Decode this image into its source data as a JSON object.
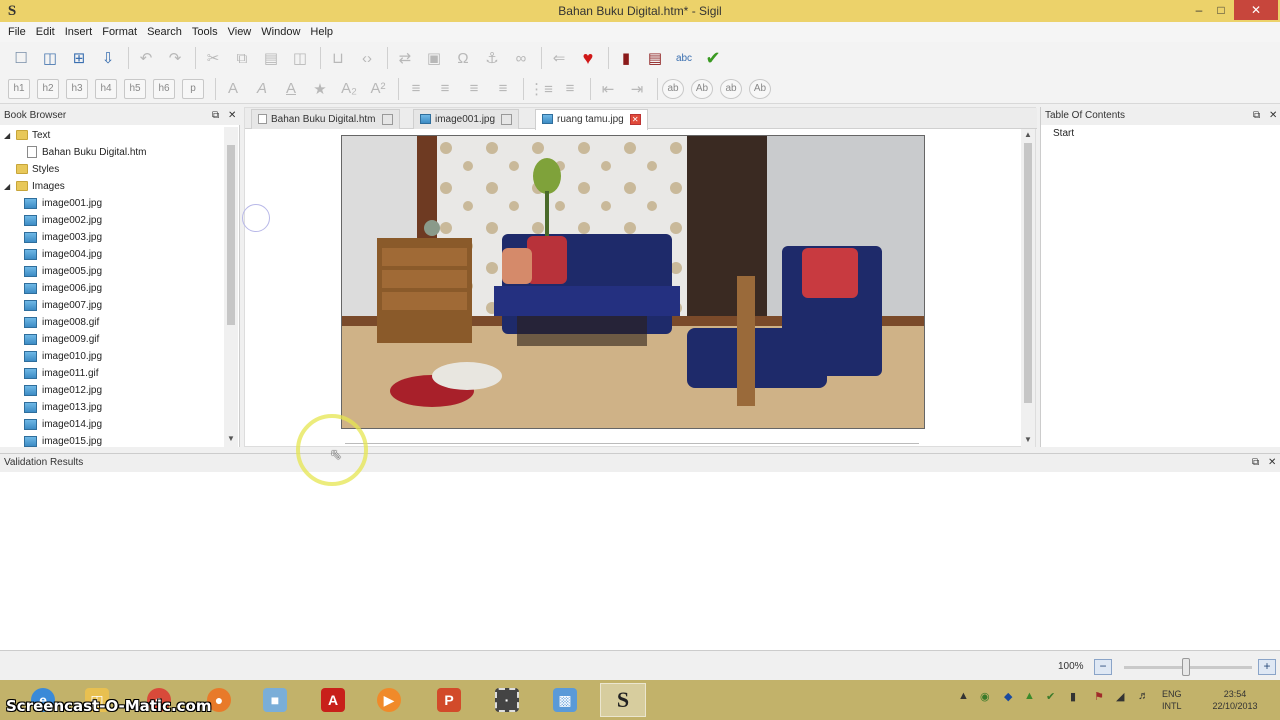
{
  "window": {
    "title": "Bahan Buku Digital.htm* - Sigil",
    "app_icon": "S",
    "minimize": "–",
    "maximize": "□",
    "close": "✕"
  },
  "menu": [
    "File",
    "Edit",
    "Insert",
    "Format",
    "Search",
    "Tools",
    "View",
    "Window",
    "Help"
  ],
  "toolbar2": {
    "headings": [
      "h1",
      "h2",
      "h3",
      "h4",
      "h5",
      "h6",
      "p"
    ],
    "case_buttons": [
      "ab",
      "Ab",
      "ab",
      "Ab"
    ]
  },
  "book_browser": {
    "title": "Book Browser",
    "tree": [
      {
        "label": "Text",
        "type": "folder",
        "level": 0,
        "expanded": true
      },
      {
        "label": "Bahan Buku Digital.htm",
        "type": "file",
        "level": 1
      },
      {
        "label": "Styles",
        "type": "folder",
        "level": 0
      },
      {
        "label": "Images",
        "type": "folder",
        "level": 0,
        "expanded": true
      },
      {
        "label": "image001.jpg",
        "type": "image",
        "level": 1
      },
      {
        "label": "image002.jpg",
        "type": "image",
        "level": 1
      },
      {
        "label": "image003.jpg",
        "type": "image",
        "level": 1
      },
      {
        "label": "image004.jpg",
        "type": "image",
        "level": 1
      },
      {
        "label": "image005.jpg",
        "type": "image",
        "level": 1
      },
      {
        "label": "image006.jpg",
        "type": "image",
        "level": 1
      },
      {
        "label": "image007.jpg",
        "type": "image",
        "level": 1
      },
      {
        "label": "image008.gif",
        "type": "image",
        "level": 1
      },
      {
        "label": "image009.gif",
        "type": "image",
        "level": 1
      },
      {
        "label": "image010.jpg",
        "type": "image",
        "level": 1
      },
      {
        "label": "image011.gif",
        "type": "image",
        "level": 1
      },
      {
        "label": "image012.jpg",
        "type": "image",
        "level": 1
      },
      {
        "label": "image013.jpg",
        "type": "image",
        "level": 1
      },
      {
        "label": "image014.jpg",
        "type": "image",
        "level": 1
      },
      {
        "label": "image015.jpg",
        "type": "image",
        "level": 1
      }
    ]
  },
  "editor": {
    "tabs": [
      {
        "label": "Bahan Buku Digital.htm",
        "icon": "html-file-icon",
        "active": false
      },
      {
        "label": "image001.jpg",
        "icon": "image-file-icon",
        "active": false
      },
      {
        "label": "ruang tamu.jpg",
        "icon": "image-file-icon",
        "active": true
      }
    ]
  },
  "toc": {
    "title": "Table Of Contents",
    "entries": [
      "Start"
    ]
  },
  "validation": {
    "title": "Validation Results"
  },
  "statusbar": {
    "zoom": "100%",
    "zoom_out": "−",
    "zoom_in": "+"
  },
  "taskbar": {
    "watermark": "Screencast-O-Matic.com",
    "language": "ENG",
    "layout": "INTL",
    "time": "23:54",
    "date": "22/10/2013"
  },
  "colors": {
    "titlebar": "#ecd26a",
    "taskbar": "#c2b26a",
    "close_button": "#c7463c",
    "active_tab_close": "#e04a3a"
  }
}
